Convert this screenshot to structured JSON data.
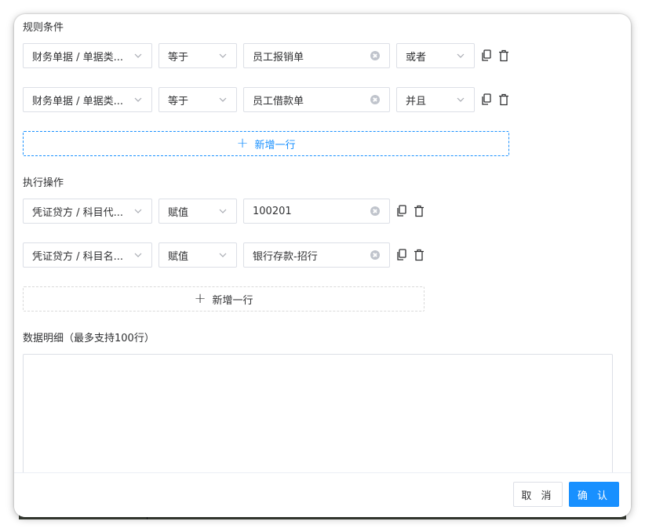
{
  "rules": {
    "label": "规则条件",
    "rows": [
      {
        "field": "财务单据 / 单据类...",
        "operator": "等于",
        "value": "员工报销单",
        "logic": "或者"
      },
      {
        "field": "财务单据 / 单据类...",
        "operator": "等于",
        "value": "员工借款单",
        "logic": "并且"
      }
    ],
    "add_label": "新增一行"
  },
  "actions": {
    "label": "执行操作",
    "rows": [
      {
        "field": "凭证贷方 / 科目代...",
        "operator": "赋值",
        "value": "100201"
      },
      {
        "field": "凭证贷方 / 科目名...",
        "operator": "赋值",
        "value": "银行存款-招行"
      }
    ],
    "add_label": "新增一行"
  },
  "detail": {
    "label": "数据明细（最多支持100行）",
    "value": ""
  },
  "footer": {
    "cancel_label": "取 消",
    "confirm_label": "确 认"
  },
  "colors": {
    "primary": "#1890ff",
    "border": "#dcdfe6",
    "text": "#303133"
  },
  "icons": {
    "copy": "copy-icon",
    "delete": "trash-icon",
    "clear": "clear-circle-icon",
    "dropdown": "chevron-down-icon",
    "add": "plus-icon"
  }
}
